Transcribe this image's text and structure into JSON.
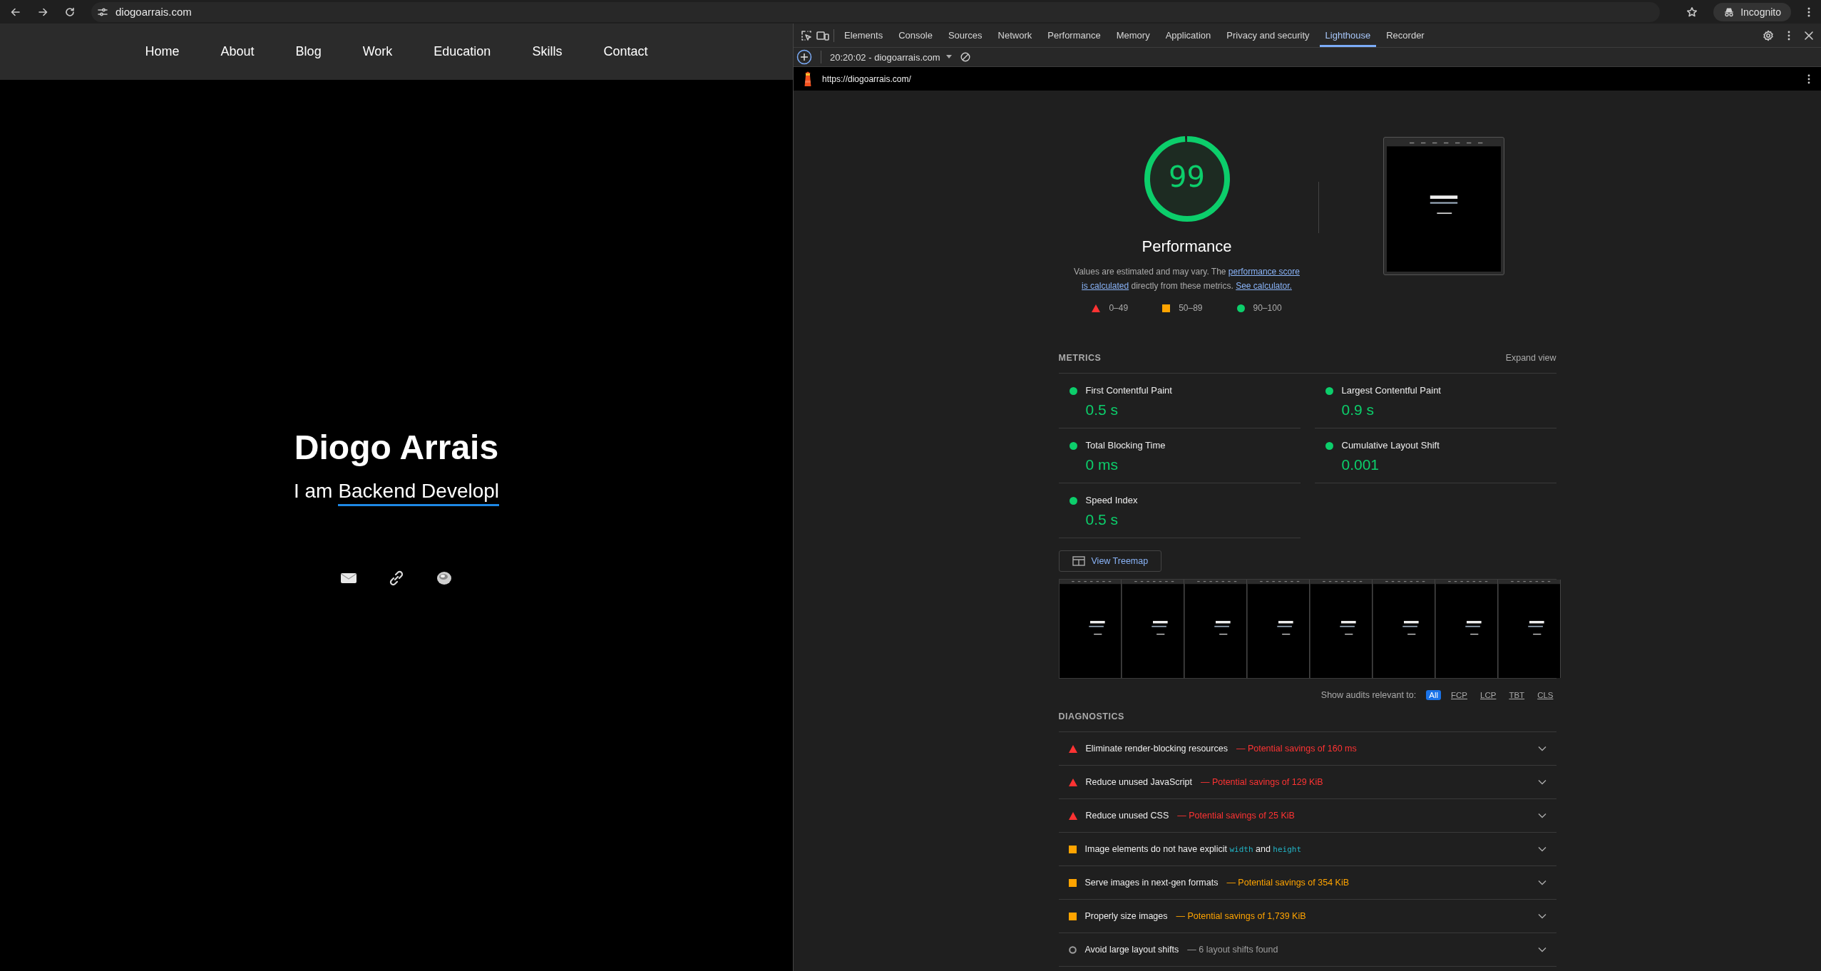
{
  "browser": {
    "address": "diogoarrais.com",
    "profile": "Incognito"
  },
  "site": {
    "nav": [
      "Home",
      "About",
      "Blog",
      "Work",
      "Education",
      "Skills",
      "Contact"
    ],
    "hero": {
      "title": "Diogo Arrais",
      "subtitle_prefix": "I am",
      "typed_text": "Backend Developl"
    }
  },
  "devtools": {
    "tabs": [
      {
        "label": "Elements",
        "selected": false
      },
      {
        "label": "Console",
        "selected": false
      },
      {
        "label": "Sources",
        "selected": false
      },
      {
        "label": "Network",
        "selected": false
      },
      {
        "label": "Performance",
        "selected": false
      },
      {
        "label": "Memory",
        "selected": false
      },
      {
        "label": "Application",
        "selected": false
      },
      {
        "label": "Privacy and security",
        "selected": false
      },
      {
        "label": "Lighthouse",
        "selected": true
      },
      {
        "label": "Recorder",
        "selected": false
      }
    ],
    "report_selector": "20:20:02 - diogoarrais.com",
    "url": "https://diogoarrais.com/",
    "report": {
      "gauge": {
        "score": "99",
        "level": 0.99,
        "title": "Performance"
      },
      "description": [
        {
          "text": "Values are estimated and may vary. The ",
          "kind": "plain"
        },
        {
          "text": "performance score",
          "kind": "link"
        },
        {
          "text": "is calculated",
          "kind": "link"
        },
        {
          "text": " directly from these metrics. ",
          "kind": "plain"
        },
        {
          "text": "See calculator.",
          "kind": "link"
        }
      ],
      "legend": [
        {
          "kind": "fail",
          "label": "0–49"
        },
        {
          "kind": "average",
          "label": "50–89"
        },
        {
          "kind": "pass",
          "label": "90–100"
        }
      ],
      "metrics_heading": "METRICS",
      "expand_label": "Expand view",
      "metrics": [
        {
          "title": "First Contentful Paint",
          "value": "0.5 s",
          "kind": "pass"
        },
        {
          "title": "Largest Contentful Paint",
          "value": "0.9 s",
          "kind": "pass"
        },
        {
          "title": "Total Blocking Time",
          "value": "0 ms",
          "kind": "pass"
        },
        {
          "title": "Cumulative Layout Shift",
          "value": "0.001",
          "kind": "pass"
        },
        {
          "title": "Speed Index",
          "value": "0.5 s",
          "kind": "pass"
        }
      ],
      "treemap_button": "View Treemap",
      "filter_label": "Show audits relevant to:",
      "filters": [
        {
          "label": "All",
          "selected": true
        },
        {
          "label": "FCP",
          "selected": false
        },
        {
          "label": "LCP",
          "selected": false
        },
        {
          "label": "TBT",
          "selected": false
        },
        {
          "label": "CLS",
          "selected": false
        }
      ],
      "diagnostics_heading": "DIAGNOSTICS",
      "diagnostics": [
        {
          "kind": "fail",
          "title_parts": [
            {
              "text": "Eliminate render-blocking resources",
              "kind": "plain"
            }
          ],
          "savings": "— Potential savings of 160 ms"
        },
        {
          "kind": "fail",
          "title_parts": [
            {
              "text": "Reduce unused JavaScript",
              "kind": "plain"
            }
          ],
          "savings": "— Potential savings of 129 KiB"
        },
        {
          "kind": "fail",
          "title_parts": [
            {
              "text": "Reduce unused CSS",
              "kind": "plain"
            }
          ],
          "savings": "— Potential savings of 25 KiB"
        },
        {
          "kind": "average",
          "title_parts": [
            {
              "text": "Image elements do not have explicit",
              "kind": "plain"
            },
            {
              "text": "width",
              "kind": "code"
            },
            {
              "text": "and",
              "kind": "plain"
            },
            {
              "text": "height",
              "kind": "code"
            }
          ]
        },
        {
          "kind": "average",
          "title_parts": [
            {
              "text": "Serve images in next-gen formats",
              "kind": "plain"
            }
          ],
          "savings": "— Potential savings of 354 KiB"
        },
        {
          "kind": "average",
          "title_parts": [
            {
              "text": "Properly size images",
              "kind": "plain"
            }
          ],
          "savings": "— Potential savings of 1,739 KiB"
        },
        {
          "kind": "informative",
          "title_parts": [
            {
              "text": "Avoid large layout shifts",
              "kind": "plain"
            }
          ],
          "savings": "— 6 layout shifts found"
        }
      ]
    }
  }
}
